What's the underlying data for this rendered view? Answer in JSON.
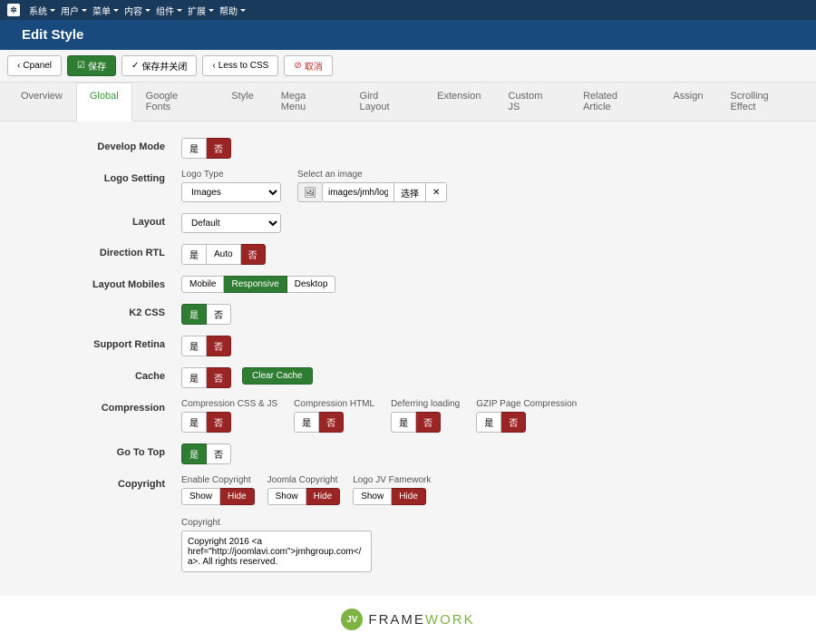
{
  "topbar": [
    "系统",
    "用户",
    "菜单",
    "内容",
    "组件",
    "扩展",
    "帮助"
  ],
  "header": {
    "title": "Edit Style"
  },
  "toolbar": {
    "cpanel": "Cpanel",
    "save": "保存",
    "save_close": "保存并关闭",
    "less_to_css": "Less to CSS",
    "cancel": "取消"
  },
  "tabs": [
    "Overview",
    "Global",
    "Google Fonts",
    "Style",
    "Mega Menu",
    "Gird Layout",
    "Extension",
    "Custom JS",
    "Related Article",
    "Assign",
    "Scrolling Effect"
  ],
  "active_tab": "Global",
  "yes": "是",
  "no": "否",
  "rows": {
    "develop_mode": {
      "label": "Develop Mode",
      "value": "否"
    },
    "logo_setting": {
      "label": "Logo Setting",
      "logo_type_label": "Logo Type",
      "logo_type": "Images",
      "select_image_label": "Select an image",
      "image_value": "images/jmh/logo.png",
      "select_btn": "选择",
      "clear_btn": "✕"
    },
    "layout": {
      "label": "Layout",
      "value": "Default"
    },
    "direction_rtl": {
      "label": "Direction RTL",
      "options": [
        "是",
        "Auto",
        "否"
      ],
      "value": "否"
    },
    "layout_mobiles": {
      "label": "Layout Mobiles",
      "options": [
        "Mobile",
        "Responsive",
        "Desktop"
      ],
      "value": "Responsive"
    },
    "k2_css": {
      "label": "K2 CSS",
      "value": "是"
    },
    "support_retina": {
      "label": "Support Retina",
      "value": "否"
    },
    "cache": {
      "label": "Cache",
      "value": "否",
      "clear_btn": "Clear Cache"
    },
    "compression": {
      "label": "Compression",
      "cols": [
        {
          "label": "Compression CSS & JS",
          "value": "否"
        },
        {
          "label": "Compression HTML",
          "value": "否"
        },
        {
          "label": "Deferring loading",
          "value": "否"
        },
        {
          "label": "GZIP Page Compression",
          "value": "否"
        }
      ]
    },
    "go_to_top": {
      "label": "Go To Top",
      "value": "是"
    },
    "copyright": {
      "label": "Copyright",
      "cols": [
        {
          "label": "Enable Copyright",
          "options": [
            "Show",
            "Hide"
          ],
          "value": "Hide"
        },
        {
          "label": "Joomla Copyright",
          "options": [
            "Show",
            "Hide"
          ],
          "value": "Hide"
        },
        {
          "label": "Logo JV Famework",
          "options": [
            "Show",
            "Hide"
          ],
          "value": "Hide"
        }
      ],
      "text_label": "Copyright",
      "text": "Copyright 2016 <a href=\"http://joomlavi.com\">jmhgroup.com</a>. All rights reserved."
    }
  },
  "footer": {
    "badge": "JV",
    "text1": "FRAME",
    "text2": "WORK"
  }
}
